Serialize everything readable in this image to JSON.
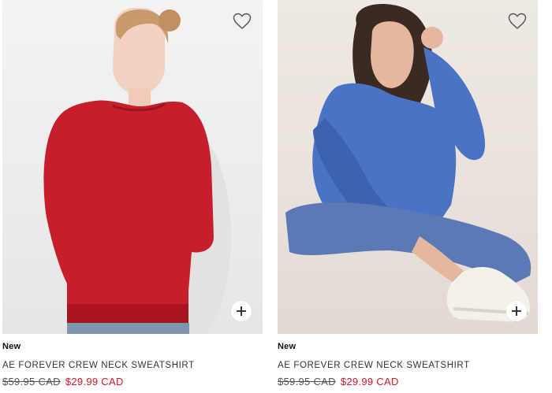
{
  "products": [
    {
      "badge": "New",
      "name": "AE FOREVER CREW NECK SWEATSHIRT",
      "original_price": "$59.95 CAD",
      "sale_price": "$29.99 CAD",
      "sweater_color": "#c81e2c",
      "image": "model-red-sweatshirt"
    },
    {
      "badge": "New",
      "name": "AE FOREVER CREW NECK SWEATSHIRT",
      "original_price": "$59.95 CAD",
      "sale_price": "$29.99 CAD",
      "sweater_color": "#4a73c6",
      "image": "model-blue-sweatshirt"
    }
  ],
  "icons": {
    "favorite": "heart-outline-icon",
    "quick_add": "plus-icon"
  },
  "colors": {
    "sale": "#d3192d",
    "text": "#333333"
  }
}
